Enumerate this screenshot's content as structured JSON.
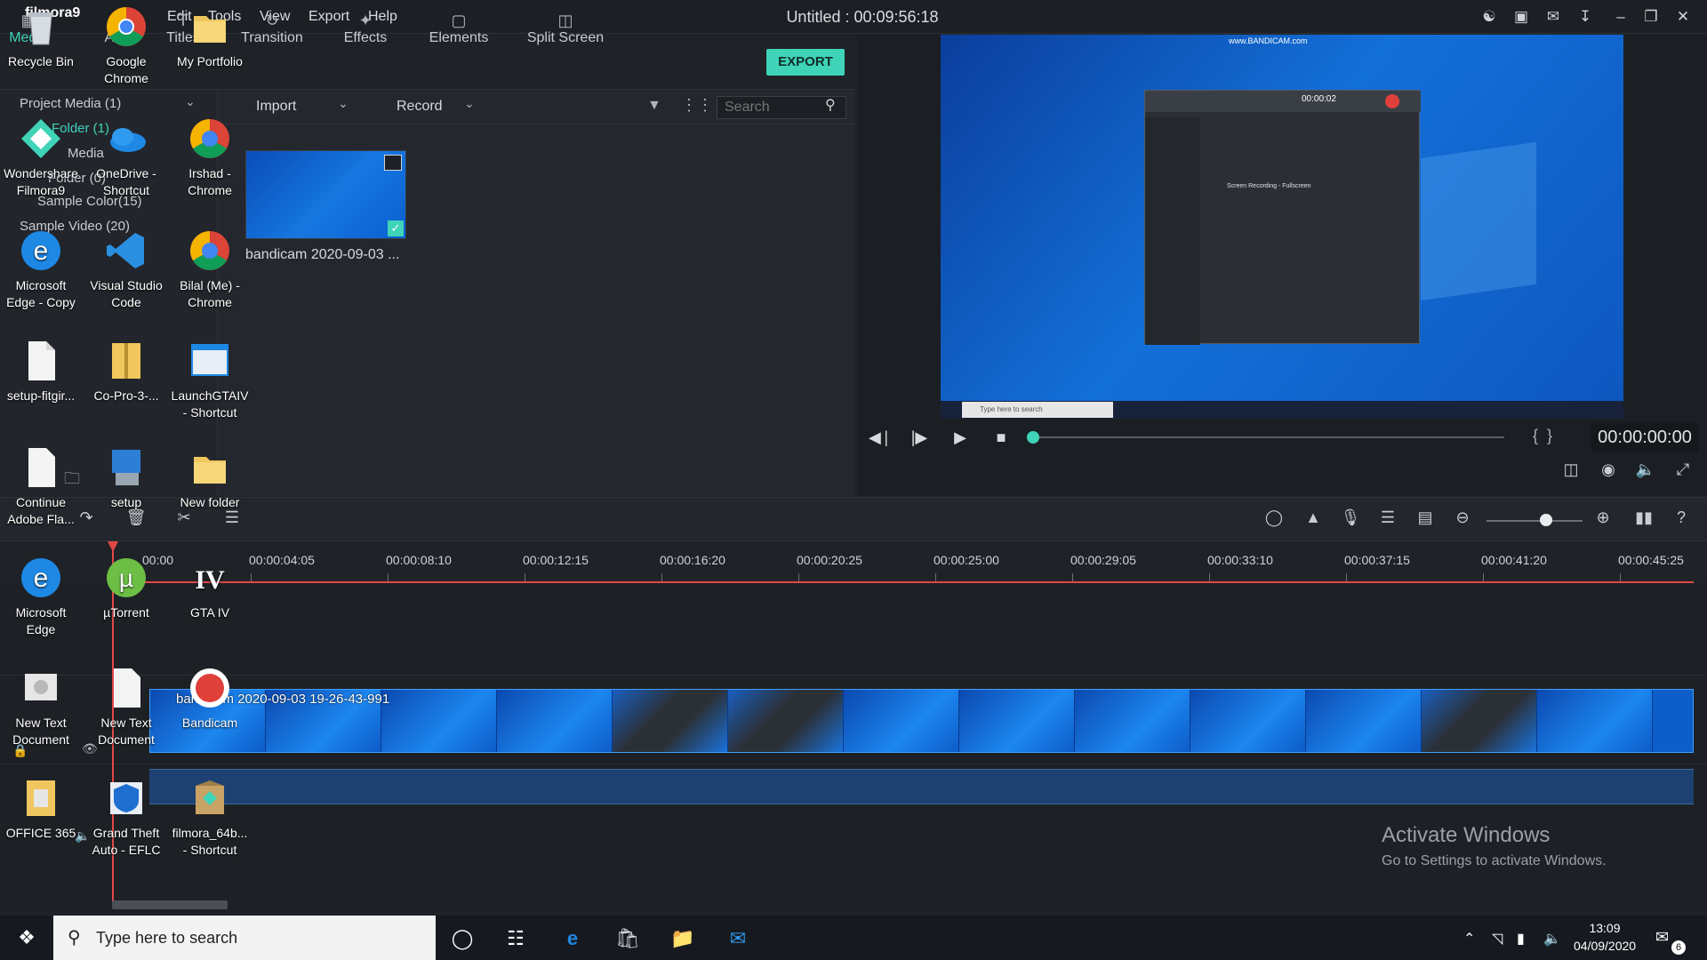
{
  "menu": {
    "edit": "Edit",
    "tools": "Tools",
    "view": "View",
    "export": "Export",
    "help": "Help"
  },
  "window_title": "Untitled : 00:09:56:18",
  "tabs": [
    {
      "label": "Media"
    },
    {
      "label": "Audio"
    },
    {
      "label": "Titles"
    },
    {
      "label": "Transition"
    },
    {
      "label": "Effects"
    },
    {
      "label": "Elements"
    },
    {
      "label": "Split Screen"
    }
  ],
  "export_label": "EXPORT",
  "sidebar": {
    "project_media": "Project Media (1)",
    "folder": "Folder (1)",
    "folder0": "Folder (0)",
    "media": "Media",
    "sample_color": "Sample Color(15)",
    "sample_video": "Sample Video (20)"
  },
  "toolbar": {
    "import": "Import",
    "record": "Record",
    "search_placeholder": "Search"
  },
  "media_item": {
    "caption": "bandicam 2020-09-03 ..."
  },
  "preview": {
    "watermark": "www.BANDICAM.com",
    "timecode": "00:00:00:00",
    "rec_time": "00:00:02",
    "panel_title": "Screen Recording - Fullscreen",
    "taskbar_search": "Type here to search"
  },
  "ruler": {
    "ticks": [
      "00:00",
      "00:00:04:05",
      "00:00:08:10",
      "00:00:12:15",
      "00:00:16:20",
      "00:00:20:25",
      "00:00:25:00",
      "00:00:29:05",
      "00:00:33:10",
      "00:00:37:15",
      "00:00:41:20",
      "00:00:45:25"
    ]
  },
  "clip": {
    "label": "bandicam 2020-09-03 19-26-43-991"
  },
  "watermark": {
    "line1": "Activate Windows",
    "line2": "Go to Settings to activate Windows."
  },
  "desktop_icons": [
    {
      "label": "Recycle Bin"
    },
    {
      "label": "Google Chrome"
    },
    {
      "label": "My Portfolio"
    },
    {
      "label": "Wondershare Filmora9"
    },
    {
      "label": "OneDrive - Shortcut"
    },
    {
      "label": "Irshad - Chrome"
    },
    {
      "label": "Microsoft Edge - Copy"
    },
    {
      "label": "Visual Studio Code"
    },
    {
      "label": "Bilal (Me) - Chrome"
    },
    {
      "label": "setup-fitgir..."
    },
    {
      "label": "Co-Pro-3-..."
    },
    {
      "label": "LaunchGTAIV - Shortcut"
    },
    {
      "label": "Continue Adobe Fla..."
    },
    {
      "label": "setup"
    },
    {
      "label": "New folder"
    },
    {
      "label": "Microsoft Edge"
    },
    {
      "label": "µTorrent"
    },
    {
      "label": "GTA IV"
    },
    {
      "label": "New Text Document"
    },
    {
      "label": "New Text Document"
    },
    {
      "label": "Bandicam"
    },
    {
      "label": "OFFICE 365"
    },
    {
      "label": "Grand Theft Auto - EFLC"
    },
    {
      "label": "filmora_64b... - Shortcut"
    }
  ],
  "taskbar": {
    "search_placeholder": "Type here to search",
    "time": "13:09",
    "date": "04/09/2020",
    "notifications": "6"
  },
  "colors": {
    "accent": "#3fd3b8",
    "playhead": "#e04848",
    "clip": "#0d5ec9"
  }
}
